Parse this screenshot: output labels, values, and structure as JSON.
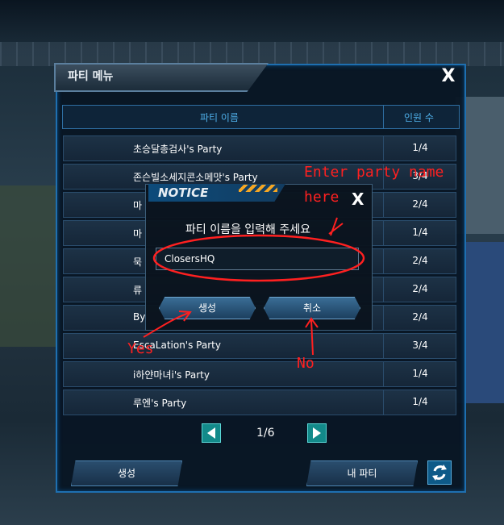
{
  "window": {
    "title": "파티 메뉴",
    "close_label": "X"
  },
  "table": {
    "header_name": "파티 이름",
    "header_count": "인원 수",
    "rows": [
      {
        "name": "초승달총검사's Party",
        "count": "1/4"
      },
      {
        "name": "존슨빌소세지콘소메맛's Party",
        "count": "3/4"
      },
      {
        "name": "마",
        "count": "2/4"
      },
      {
        "name": "마",
        "count": "1/4"
      },
      {
        "name": "묵",
        "count": "2/4"
      },
      {
        "name": "류",
        "count": "2/4"
      },
      {
        "name": "By",
        "count": "2/4"
      },
      {
        "name": "EscaLation's Party",
        "count": "3/4"
      },
      {
        "name": "i하얀마녀i's Party",
        "count": "1/4"
      },
      {
        "name": "루엔's Party",
        "count": "1/4"
      }
    ]
  },
  "pager": {
    "page": "1/6"
  },
  "bottom": {
    "create_label": "생성",
    "my_party_label": "내 파티"
  },
  "notice": {
    "title": "NOTICE",
    "close_label": "X",
    "message": "파티 이름을 입력해 주세요",
    "input_value": "ClosersHQ",
    "ok_label": "생성",
    "cancel_label": "취소"
  },
  "annotations": {
    "enter_party_name_line1": "Enter party name",
    "enter_party_name_line2": "here",
    "yes": "Yes",
    "no": "No",
    "color": "#ff2020"
  }
}
